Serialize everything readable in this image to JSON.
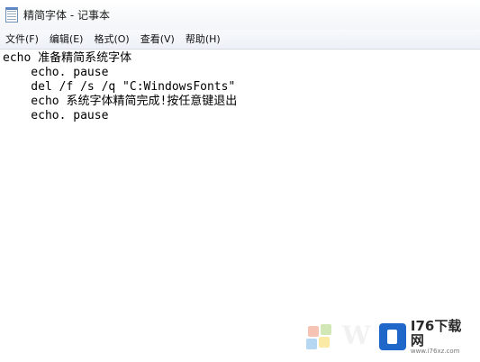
{
  "window": {
    "title": "精简字体 - 记事本"
  },
  "menu": {
    "items": [
      "文件(F)",
      "编辑(E)",
      "格式(O)",
      "查看(V)",
      "帮助(H)"
    ]
  },
  "editor": {
    "lines": [
      "echo 准备精简系统字体",
      "    echo. pause",
      "    del /f /s /q \"C:WindowsFonts\"",
      "    echo 系统字体精简完成!按任意键退出",
      "    echo. pause"
    ]
  },
  "watermark": {
    "brand": "I76下载网",
    "url": "www.i76xz.com",
    "left_letter": "W",
    "box_color": "#1f67c8"
  }
}
